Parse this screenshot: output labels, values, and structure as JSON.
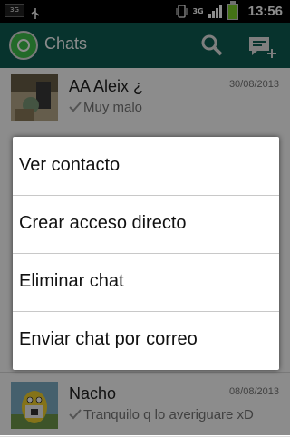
{
  "status_bar": {
    "network_badge": "3G",
    "data_type": "3G",
    "time": "13:56",
    "icons": [
      "usb-icon",
      "vibrate-icon",
      "signal-icon",
      "battery-icon"
    ]
  },
  "action_bar": {
    "title": "Chats",
    "color": "#0d5e53",
    "icons": [
      "whatsapp-logo-icon",
      "search-icon",
      "new-chat-icon"
    ]
  },
  "chats": [
    {
      "name": "AA Aleix ¿",
      "date": "30/08/2013",
      "preview": "Muy malo"
    },
    {
      "name": "Nacho",
      "date": "08/08/2013",
      "preview": "Tranquilo q lo averiguare xD"
    }
  ],
  "context_menu": {
    "items": [
      {
        "label": "Ver contacto"
      },
      {
        "label": "Crear acceso directo"
      },
      {
        "label": "Eliminar chat"
      },
      {
        "label": "Enviar chat por correo"
      }
    ]
  }
}
